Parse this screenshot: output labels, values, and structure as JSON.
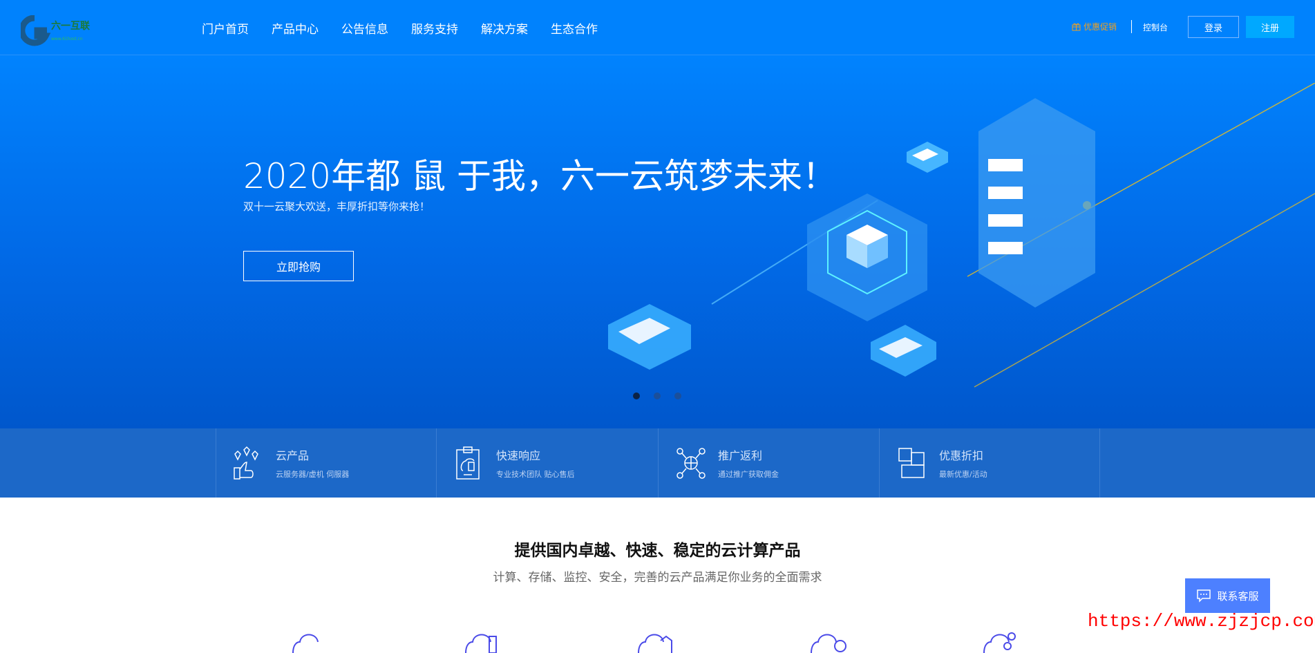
{
  "header": {
    "logo_text": "六一互联",
    "logo_url_text": "www.61host.cn",
    "nav": [
      "门户首页",
      "产品中心",
      "公告信息",
      "服务支持",
      "解决方案",
      "生态合作"
    ],
    "promo": "优惠促销",
    "console": "控制台",
    "login": "登录",
    "register": "注册",
    "promo_color": "#f0a020"
  },
  "hero": {
    "title": "2020年都 鼠 于我，六一云筑梦未来！",
    "subtitle": "双十一云聚大欢送，丰厚折扣等你来抢！",
    "button": "立即抢购",
    "slides": 3,
    "active_slide": 1
  },
  "features": [
    {
      "icon": "cloud-products-icon",
      "title": "云产品",
      "desc": "云服务器/虚机 伺服器"
    },
    {
      "icon": "clipboard-icon",
      "title": "快速响应",
      "desc": "专业技术团队 贴心售后"
    },
    {
      "icon": "globe-network-icon",
      "title": "推广返利",
      "desc": "通过推广获取佣金"
    },
    {
      "icon": "puzzle-icon",
      "title": "优惠折扣",
      "desc": "最新优惠/活动"
    }
  ],
  "section": {
    "title": "提供国内卓越、快速、稳定的云计算产品",
    "subtitle": "计算、存储、监控、安全，完善的云产品满足你业务的全面需求"
  },
  "chat": {
    "label": "联系客服"
  },
  "watermark": "https://www.zjzjcp.com"
}
